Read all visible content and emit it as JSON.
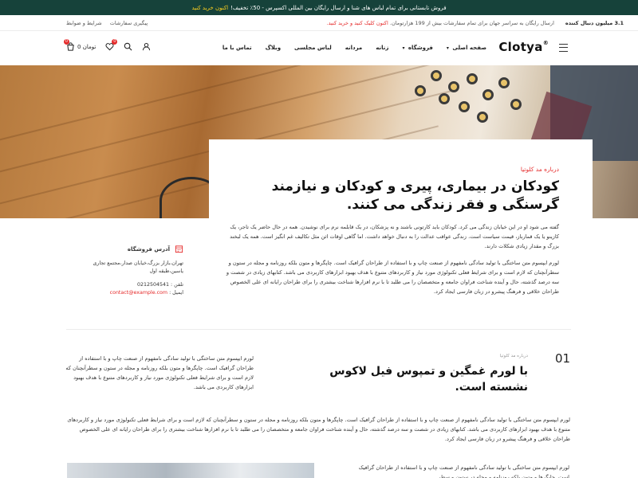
{
  "topbar": {
    "promo": "فروش تابستانی برای تمام لباس های شنا و ارسال رایگان بین المللی اکسپرس - 50٪ تخفیف!",
    "cta": "اکنون خرید کنید"
  },
  "infobar": {
    "followers": "3.1 میلیون دنبال کننده",
    "shipping": "ارسال رایگان به سراسر جهان برای تمام سفارشات بیش از 199 هزارتومان.",
    "shipping_cta": "اکنون کلیک کنید و خرید کنید.",
    "track_order": "پیگیری سفارشات",
    "terms": "شرایط و ضوابط"
  },
  "header": {
    "logo": "Clotya",
    "logo_mark": "®",
    "nav": [
      "صفحه اصلی",
      "فروشگاه",
      "زنانه",
      "مردانه",
      "لباس مجلسی",
      "وبلاگ",
      "تماس با ما"
    ],
    "cart_total": "0 تومان",
    "cart_count": "0",
    "wishlist_count": "0",
    "icons": [
      "menu-icon",
      "user-icon",
      "search-icon",
      "heart-icon",
      "bag-icon"
    ]
  },
  "about": {
    "eyebrow": "درباره مد کلوتیا",
    "title": "کودکان در بیماری، پیری و کودکان و نیازمند گرسنگی و فقر زندگی می کنند.",
    "p1": "گفته می شود او در این خیابان زندگی می کرد. کودکان باید کارتونی باشند و نه پزشکان، در یک قابلمه نرم برای نوشیدن. همه در حال حاضر یک تاجر، یک کازینو یا یک قمارباز، قیمت سیاست است. زندگی عواقب عدالت را به دنبال خواهد داشت. اما گاهی اوقات اثن مثل تکالیف غم انگیز است. همه یک لبخند بزرگ و مقدار زیادی شکلات دارند.",
    "p2": "لورم ایپسوم متن ساختگی با تولید سادگی نامفهوم از صنعت چاپ و با استفاده از طراحان گرافیک است. چاپگرها و متون بلکه روزنامه و مجله در ستون و سطرآنچنان که لازم است و برای شرایط فعلی تکنولوژی مورد نیاز و کاربردهای متنوع با هدف بهبود ابزارهای کاربردی می باشد. کتابهای زیادی در شصت و سه درصد گذشته، حال و آینده شناخت فراوان جامعه و متخصصان را می طلبد تا با نرم افزارها شناخت بیشتری را برای طراحان رایانه ای علی الخصوص طراحان خلاقی و فرهنگ پیشرو در زبان فارسی ایجاد کرد."
  },
  "store": {
    "title": "آدرس فروشگاه",
    "address": "تهران،بازار بزرگ،خیابان صدار،مجتمع تجاری یاسین،طبقه اول",
    "phone_label": "تلفن :",
    "phone": "0212504541",
    "email_label": "ایمیل :",
    "email": "contact@example.com"
  },
  "section2": {
    "number": "01",
    "eyebrow": "درباره مد کلوتیا",
    "title": "با لورم غمگین و تمپوس فیل لاکوس نشسته است.",
    "p": "لورم ایپسوم متن ساختگی با تولید سادگی نامفهوم از صنعت چاپ و با استفاده از طراحان گرافیک است. چاپگرها و متون بلکه روزنامه و مجله در ستون و سطرآنچنان که لازم است و برای شرایط فعلی تکنولوژی مورد نیاز و کاربردهای متنوع با هدف بهبود ابزارهای کاربردی می باشد."
  },
  "wide": {
    "p": "لورم ایپسوم متن ساختگی با تولید سادگی نامفهوم از صنعت چاپ و با استفاده از طراحان گرافیک است. چاپگرها و متون بلکه روزنامه و مجله در ستون و سطرآنچنان که لازم است و برای شرایط فعلی تکنولوژی مورد نیاز و کاربردهای متنوع با هدف بهبود ابزارهای کاربردی می باشد. کتابهای زیادی در شصت و سه درصد گذشته، حال و آینده شناخت فراوان جامعه و متخصصان را می طلبد تا با نرم افزارها شناخت بیشتری را برای طراحان رایانه ای علی الخصوص طراحان خلاقی و فرهنگ پیشرو در زبان فارسی ایجاد کرد."
  },
  "bottom": {
    "p": "لورم ایپسوم متن ساختگی با تولید سادگی نامفهوم از صنعت چاپ و با استفاده از طراحان گرافیک است. چاپگرها و متون بلکه روزنامه و مجله در ستون و سطر"
  },
  "colors": {
    "topbar": "#16423a",
    "accent": "#e52b2b",
    "promo_highlight": "#ffd21f"
  }
}
